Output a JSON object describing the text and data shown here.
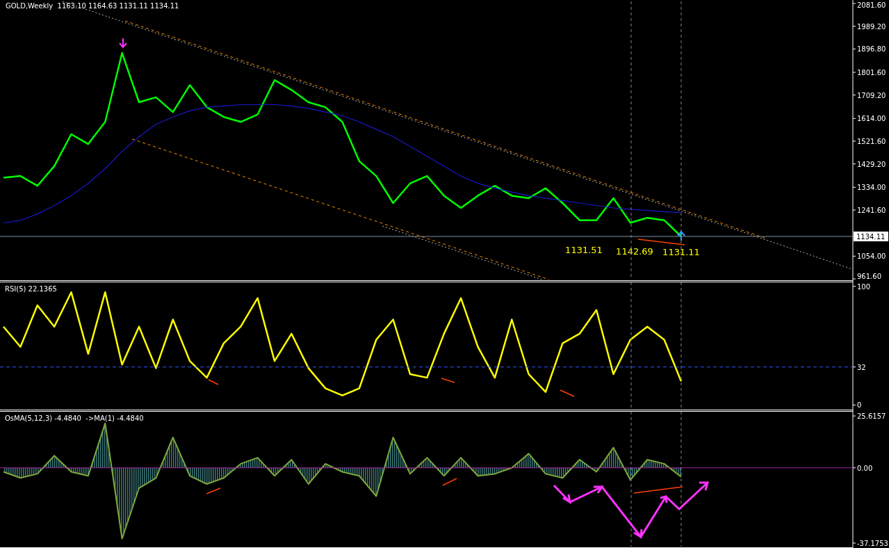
{
  "header": {
    "title": "GOLD,Weekly  1163.10 1164.63 1131.11 1134.11"
  },
  "price_panel": {
    "current_price": "1134.11",
    "chart_data": {
      "type": "line",
      "ylim": [
        953.1,
        2095.8
      ],
      "yticks": [
        {
          "value": 2081.6,
          "label": "2081.60"
        },
        {
          "value": 1989.2,
          "label": "1989.20"
        },
        {
          "value": 1896.8,
          "label": "1896.80"
        },
        {
          "value": 1801.6,
          "label": "1801.60"
        },
        {
          "value": 1709.2,
          "label": "1709.20"
        },
        {
          "value": 1614,
          "label": "1614.00"
        },
        {
          "value": 1521.6,
          "label": "1521.60"
        },
        {
          "value": 1429.2,
          "label": "1429.20"
        },
        {
          "value": 1334,
          "label": "1334.00"
        },
        {
          "value": 1241.6,
          "label": "1241.60"
        },
        {
          "value": 1054,
          "label": "1054.00"
        },
        {
          "value": 961.6,
          "label": "961.60"
        }
      ],
      "series": [
        {
          "color": "#00ff00",
          "values": [
            1373,
            1380,
            1340,
            1420,
            1550,
            1510,
            1600,
            1880,
            1680,
            1700,
            1640,
            1750,
            1660,
            1620,
            1600,
            1630,
            1770,
            1730,
            1680,
            1660,
            1600,
            1440,
            1380,
            1270,
            1350,
            1380,
            1300,
            1250,
            1300,
            1340,
            1300,
            1290,
            1330,
            1270,
            1200,
            1200,
            1290,
            1190,
            1210,
            1200,
            1134
          ]
        },
        {
          "color": "#1818c8",
          "values": [
            1188,
            1200,
            1225,
            1260,
            1300,
            1350,
            1410,
            1480,
            1540,
            1590,
            1620,
            1645,
            1660,
            1665,
            1670,
            1670,
            1670,
            1665,
            1655,
            1640,
            1625,
            1600,
            1570,
            1540,
            1500,
            1460,
            1420,
            1380,
            1350,
            1330,
            1315,
            1300,
            1290,
            1280,
            1270,
            1260,
            1250,
            1245,
            1240,
            1235,
            1231
          ]
        }
      ],
      "annotations": [
        "1131.51",
        "1142.69",
        "1131.11"
      ]
    }
  },
  "rsi_panel": {
    "label": "RSI(5) 22.1365",
    "chart_data": {
      "type": "line",
      "ylim": [
        -4.5,
        104.5
      ],
      "yticks": [
        0,
        32,
        100
      ],
      "series": [
        {
          "color": "#ffff00",
          "values": [
            66,
            49,
            84,
            66,
            95,
            43,
            95,
            34,
            66,
            31,
            72,
            37,
            23,
            52,
            66,
            90,
            37,
            60,
            31,
            14,
            8,
            14,
            55,
            72,
            26,
            23,
            60,
            90,
            49,
            23,
            72,
            26,
            11,
            52,
            60,
            80,
            26,
            55,
            66,
            55,
            20
          ]
        }
      ]
    }
  },
  "osma_panel": {
    "label": "OsMA(5,12,3) -4.4840  ->MA(1) -4.4840",
    "chart_data": {
      "type": "area",
      "ylim": [
        -39.6,
        28.4
      ],
      "yticks": [
        {
          "value": -37.1753,
          "label": "-37.1753"
        },
        {
          "value": 0,
          "label": "0.00"
        },
        {
          "value": 25.6157,
          "label": "25.6157"
        }
      ],
      "series": [
        {
          "color": "#7fa83a",
          "values": [
            -2,
            -5,
            -3,
            6,
            -2,
            -4,
            22,
            -35,
            -10,
            -5,
            15,
            -4,
            -8,
            -5,
            2,
            5,
            -4,
            4,
            -8,
            2,
            -2,
            -4,
            -14,
            15,
            -3,
            5,
            -4,
            5,
            -4,
            -3,
            0,
            7,
            -3,
            -5,
            4,
            -2,
            10,
            -6,
            4,
            2,
            -4.5
          ]
        }
      ]
    }
  }
}
